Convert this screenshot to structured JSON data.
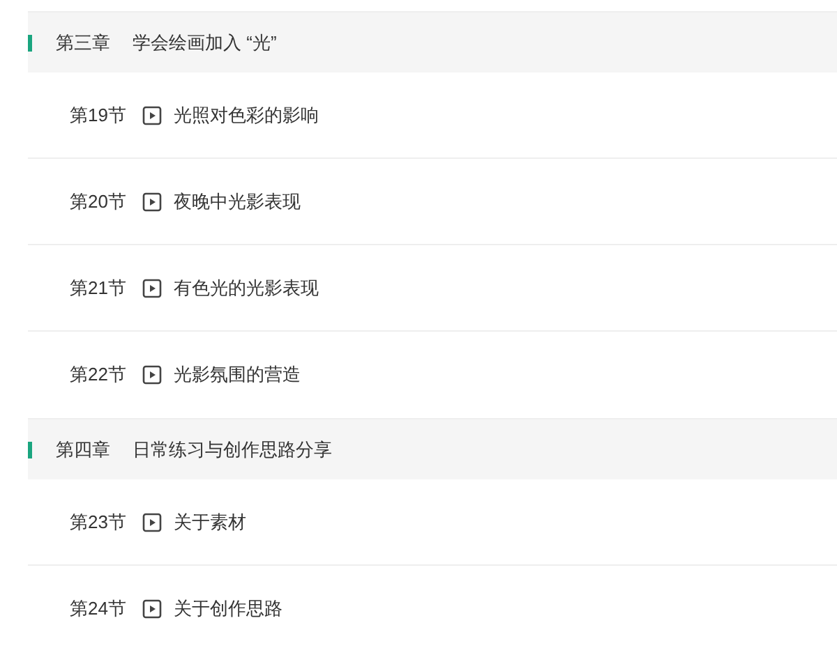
{
  "chapters": [
    {
      "number": "第三章",
      "title": "学会绘画加入 “光”",
      "lessons": [
        {
          "number": "第19节",
          "title": "光照对色彩的影响"
        },
        {
          "number": "第20节",
          "title": "夜晚中光影表现"
        },
        {
          "number": "第21节",
          "title": "有色光的光影表现"
        },
        {
          "number": "第22节",
          "title": "光影氛围的营造"
        }
      ]
    },
    {
      "number": "第四章",
      "title": "日常练习与创作思路分享",
      "lessons": [
        {
          "number": "第23节",
          "title": "关于素材"
        },
        {
          "number": "第24节",
          "title": "关于创作思路"
        }
      ]
    }
  ]
}
